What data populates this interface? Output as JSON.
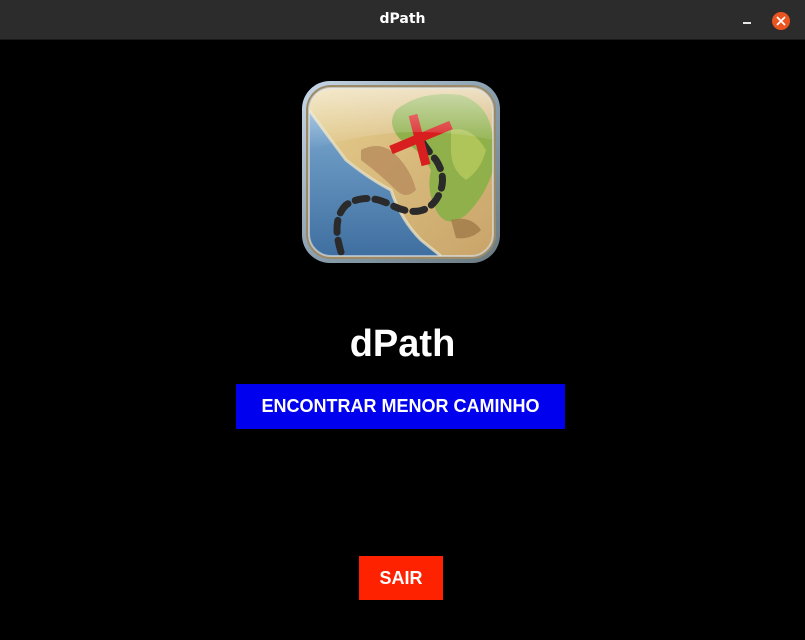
{
  "window": {
    "title": "dPath"
  },
  "icons": {
    "minimize": "minimize-icon",
    "close": "close-icon",
    "logo": "treasure-map-icon"
  },
  "colors": {
    "find_button_bg": "#0000ee",
    "exit_button_bg": "#ff2200",
    "close_button_bg": "#e9541f",
    "background": "#000000"
  },
  "main": {
    "app_title": "dPath",
    "find_path_label": "ENCONTRAR MENOR CAMINHO",
    "exit_label": "SAIR"
  }
}
